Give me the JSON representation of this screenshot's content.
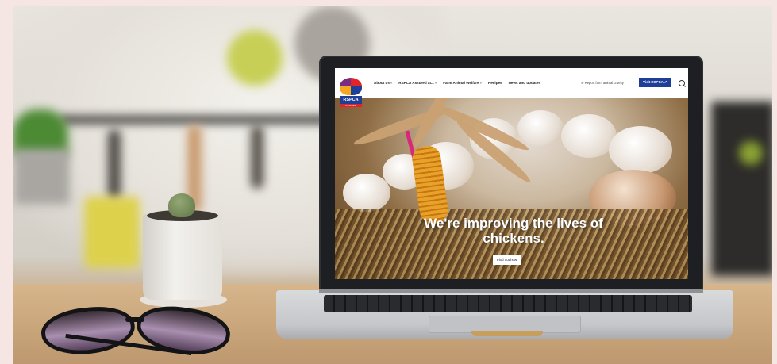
{
  "website": {
    "logo": {
      "name": "RSPCA",
      "subtitle": "ASSURED"
    },
    "nav_items": [
      {
        "label": "About us",
        "has_dropdown": true
      },
      {
        "label": "RSPCA Assured at...",
        "has_dropdown": true
      },
      {
        "label": "Farm Animal Welfare",
        "has_dropdown": true
      },
      {
        "label": "Recipes",
        "has_dropdown": false
      },
      {
        "label": "News and updates",
        "has_dropdown": false
      }
    ],
    "report_link": "Report farm animal cruelty",
    "visit_button": "Visit RSPCA",
    "hero": {
      "headline": "We're improving the lives of chickens.",
      "cta": "Find out how"
    }
  },
  "colors": {
    "brand_blue": "#1e3f95",
    "brand_red": "#e2232a",
    "page_border": "#f6e6e3"
  },
  "icons": [
    "search-icon",
    "phone-icon",
    "external-link-icon",
    "chevron-down-icon"
  ]
}
